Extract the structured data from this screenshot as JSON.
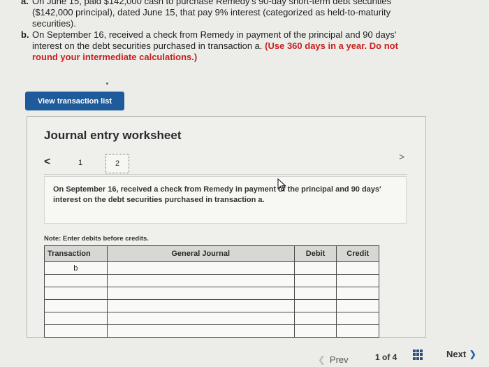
{
  "problem": {
    "item_a": {
      "label": "a.",
      "text": "On June 15, paid $142,000 cash to purchase Remedy's 90-day short-term debt securities ($142,000 principal), dated June 15, that pay 9% interest (categorized as held-to-maturity securities)."
    },
    "item_b": {
      "label": "b.",
      "text": "On September 16, received a check from Remedy in payment of the principal and 90 days' interest on the debt securities purchased in transaction a.",
      "highlight": "(Use 360 days in a year. Do not round your intermediate calculations.)"
    }
  },
  "view_transaction_label": "View transaction list",
  "worksheet": {
    "title": "Journal entry worksheet",
    "tabs": [
      "1",
      "2"
    ],
    "active_tab": "2",
    "prev_arrow": "<",
    "next_arrow": ">",
    "description": "On September 16, received a check from Remedy in payment of the principal and 90 days' interest on the debt securities purchased in transaction a.",
    "note": "Note: Enter debits before credits.",
    "table": {
      "headers": {
        "transaction": "Transaction",
        "general_journal": "General Journal",
        "debit": "Debit",
        "credit": "Credit"
      },
      "rows": [
        {
          "transaction": "b",
          "general_journal": "",
          "debit": "",
          "credit": ""
        },
        {
          "transaction": "",
          "general_journal": "",
          "debit": "",
          "credit": ""
        },
        {
          "transaction": "",
          "general_journal": "",
          "debit": "",
          "credit": ""
        },
        {
          "transaction": "",
          "general_journal": "",
          "debit": "",
          "credit": ""
        },
        {
          "transaction": "",
          "general_journal": "",
          "debit": "",
          "credit": ""
        },
        {
          "transaction": "",
          "general_journal": "",
          "debit": "",
          "credit": ""
        }
      ]
    }
  },
  "footer": {
    "prev_label": "Prev",
    "page_count": "1 of 4",
    "next_label": "Next",
    "prev_icon": "chevron-left-icon",
    "next_icon": "chevron-right-icon",
    "grid_icon": "grid-icon"
  },
  "colors": {
    "accent": "#1d5b9a",
    "highlight_text": "#c8201c",
    "background": "#ecece9"
  }
}
